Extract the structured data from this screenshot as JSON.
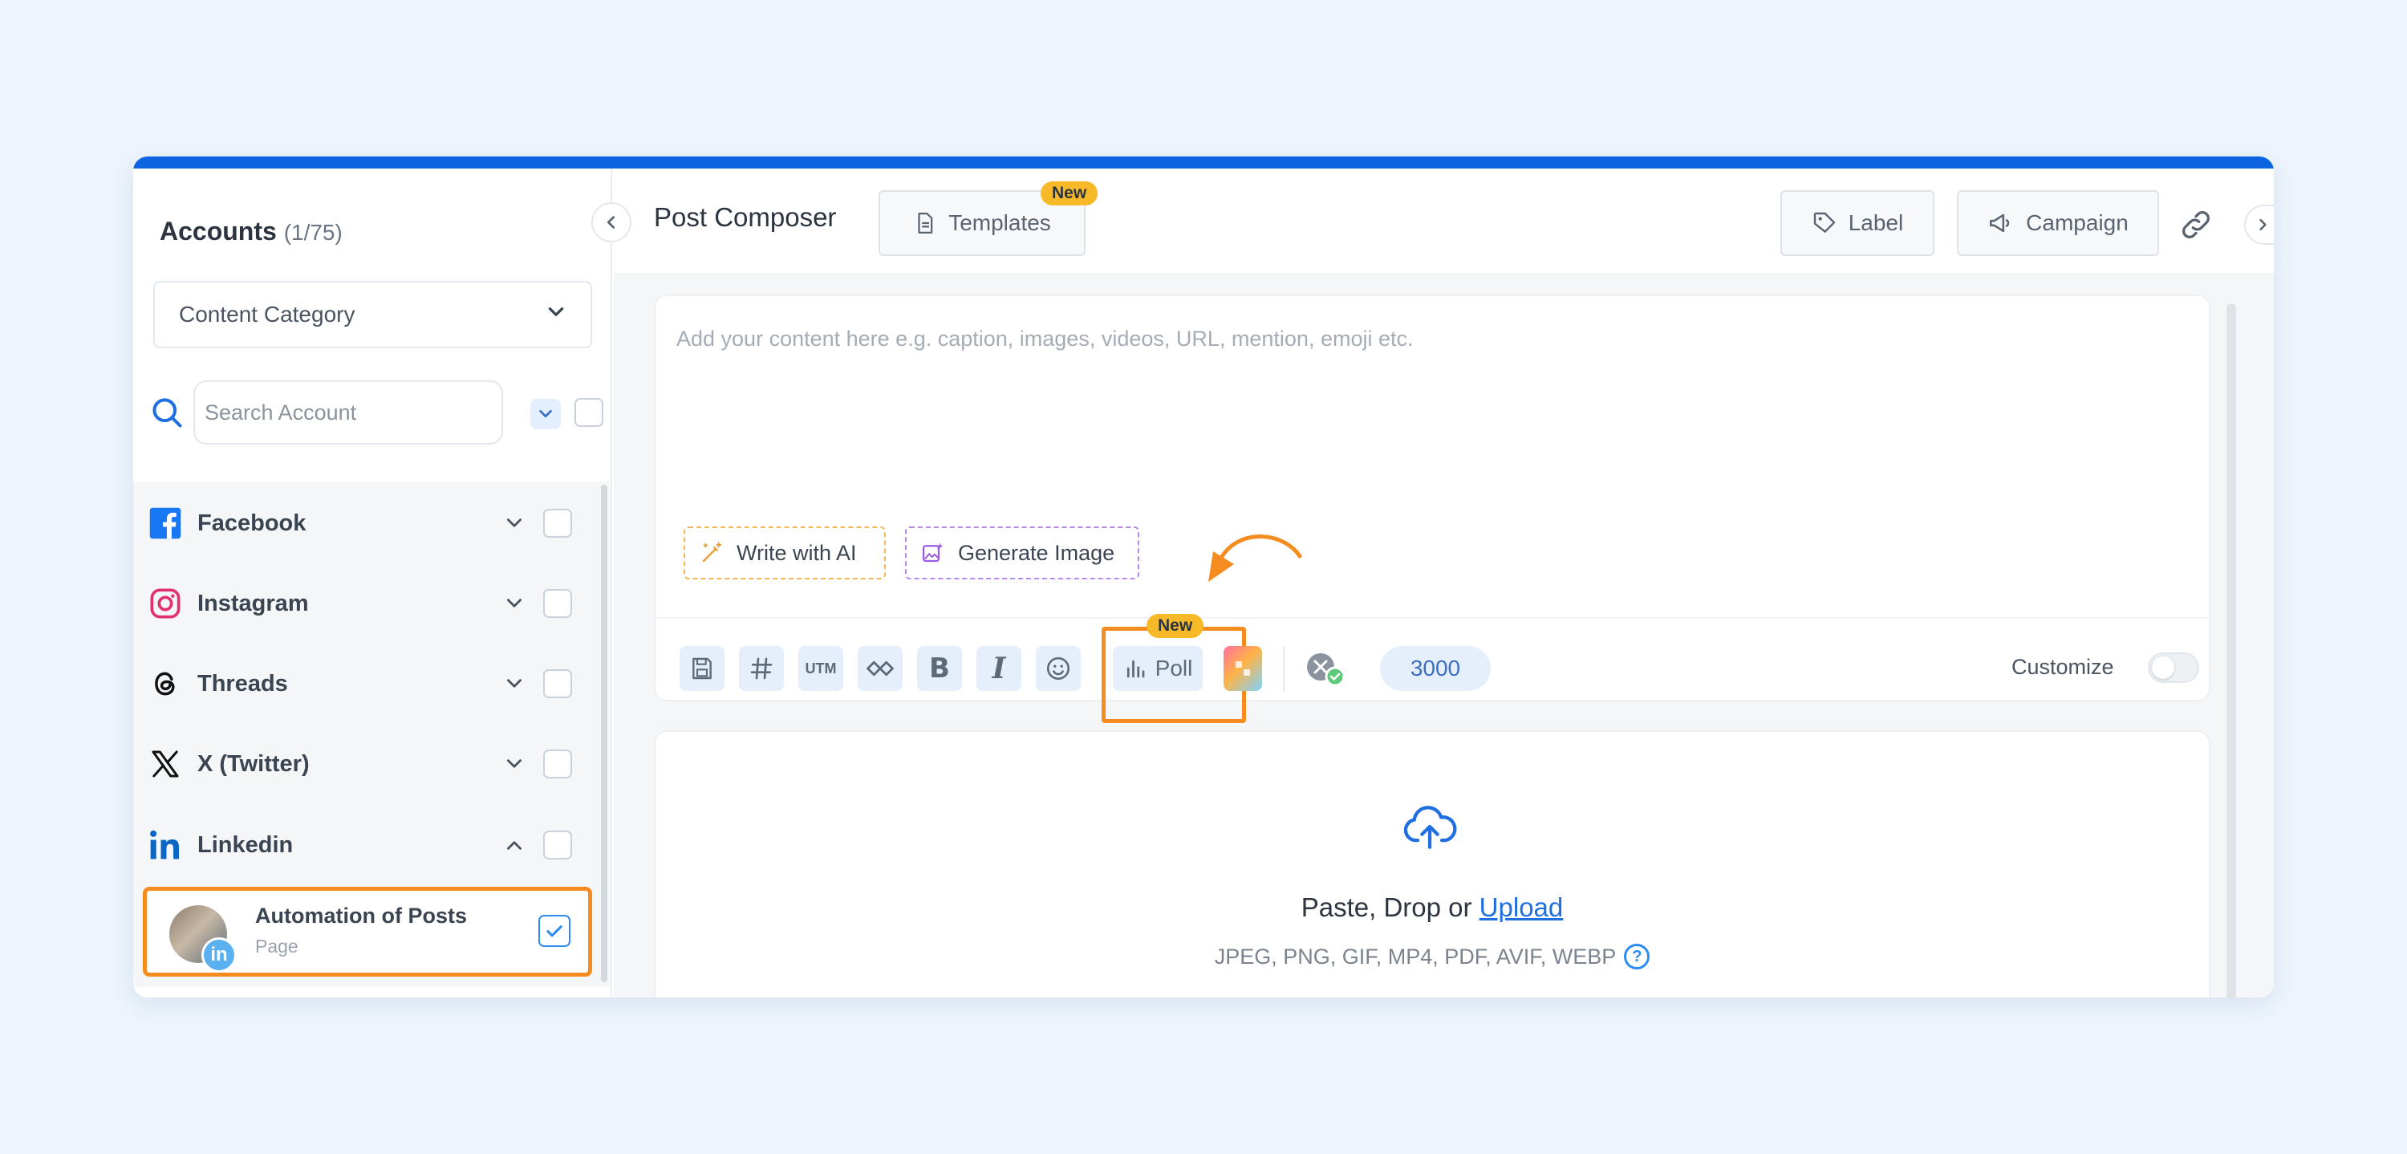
{
  "sidebar": {
    "title": "Accounts",
    "count": "(1/75)",
    "category_select": "Content Category",
    "search_placeholder": "Search Account",
    "networks": [
      {
        "label": "Facebook"
      },
      {
        "label": "Instagram"
      },
      {
        "label": "Threads"
      },
      {
        "label": "X (Twitter)"
      },
      {
        "label": "Linkedin"
      }
    ],
    "selected_account": {
      "name": "Automation of Posts",
      "type": "Page",
      "badge": "in"
    }
  },
  "header": {
    "title": "Post Composer",
    "templates_label": "Templates",
    "new_badge": "New",
    "label_button": "Label",
    "campaign_button": "Campaign"
  },
  "editor": {
    "placeholder": "Add your content here e.g. caption, images, videos, URL, mention, emoji etc.",
    "write_ai": "Write with AI",
    "generate_image": "Generate Image",
    "toolbar": {
      "utm": "UTM",
      "bold": "B",
      "italic": "I",
      "poll": "Poll",
      "poll_badge": "New",
      "char_count": "3000",
      "customize": "Customize"
    }
  },
  "upload": {
    "prefix": "Paste, Drop or ",
    "link": "Upload",
    "formats": "JPEG, PNG, GIF, MP4, PDF, AVIF, WEBP"
  },
  "colors": {
    "accent": "#0c64e0",
    "highlight": "#f58c1f",
    "badge": "#f7b928"
  }
}
